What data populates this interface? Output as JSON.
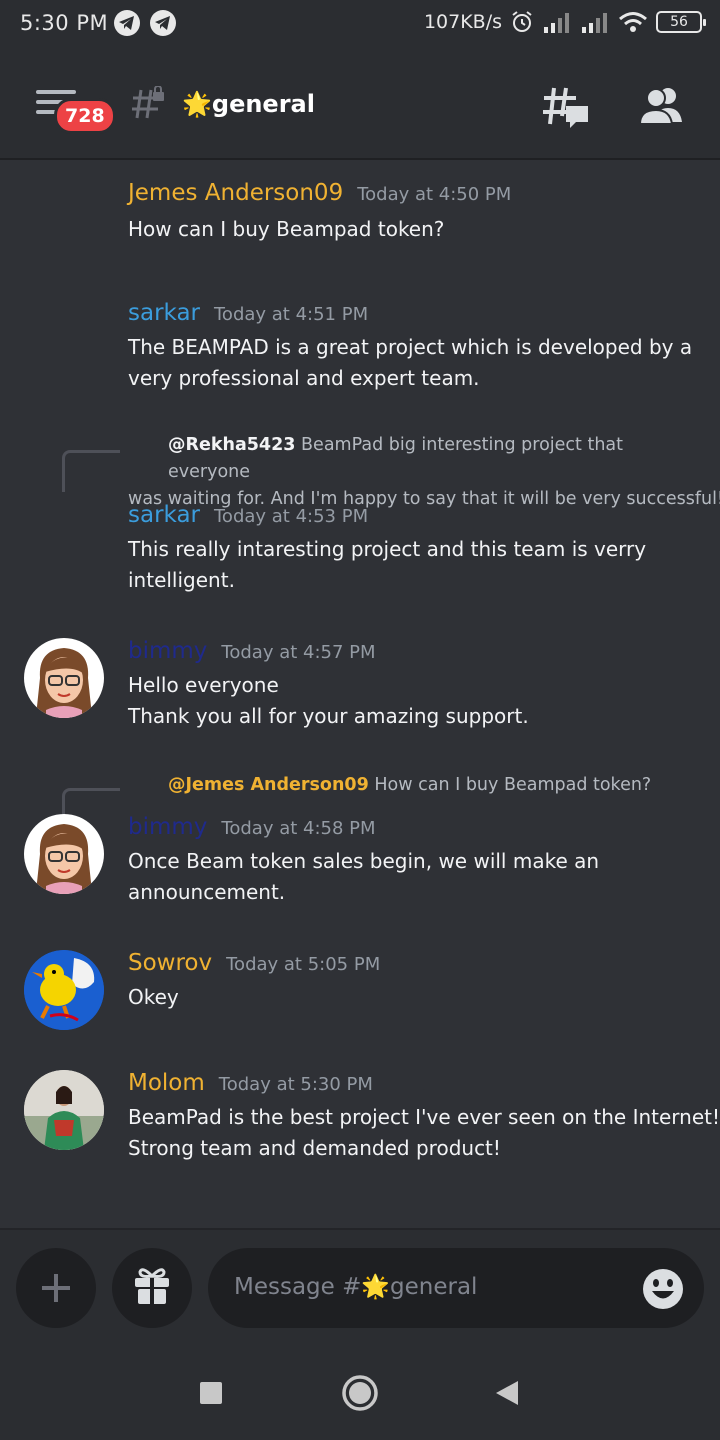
{
  "status_bar": {
    "time": "5:30 PM",
    "net_speed": "107KB/s",
    "battery": "56"
  },
  "header": {
    "unread_badge": "728",
    "channel_name": "🌟general"
  },
  "messages": [
    {
      "author": "Jemes Anderson09",
      "author_color": "#f0b232",
      "timestamp": "Today at 4:50 PM",
      "lines": [
        "How can I buy Beampad token?"
      ]
    },
    {
      "author": "sarkar",
      "author_color": "#3b9ddd",
      "timestamp": "Today at 4:51 PM",
      "lines": [
        "The BEAMPAD is a great project which is developed by a",
        "very professional and expert team."
      ]
    },
    {
      "reply_mention": "@Rekha5423",
      "reply_text": "BeamPad big interesting project that everyone",
      "reply_text_2": "was waiting for. And I'm happy to say that it will be very successful!",
      "author": "sarkar",
      "author_color": "#3b9ddd",
      "timestamp": "Today at 4:53 PM",
      "lines": [
        "This really intaresting project and this team is verry",
        "intelligent."
      ]
    },
    {
      "author": "bimmy",
      "author_color": "#1f2a8c",
      "timestamp": "Today at 4:57 PM",
      "lines": [
        "Hello everyone",
        "Thank you all for your amazing support."
      ]
    },
    {
      "reply_mention": "@Jemes Anderson09",
      "reply_mention_color": "#f0b232",
      "reply_text": "How can I buy Beampad token?",
      "author": "bimmy",
      "author_color": "#1f2a8c",
      "timestamp": "Today at 4:58 PM",
      "lines": [
        "Once Beam token sales begin, we will make an",
        "announcement."
      ]
    },
    {
      "author": "Sowrov",
      "author_color": "#f0b232",
      "timestamp": "Today at 5:05 PM",
      "lines": [
        "Okey"
      ]
    },
    {
      "author": "Molom",
      "author_color": "#f0b232",
      "timestamp": "Today at 5:30 PM",
      "lines": [
        "BeamPad is the best project I've ever seen on the Internet!",
        "Strong team and demanded product!"
      ]
    }
  ],
  "composer": {
    "placeholder": "Message #🌟general"
  },
  "icons": [
    "hamburger-icon",
    "hash-lock-icon",
    "threads-icon",
    "members-icon",
    "plus-icon",
    "gift-icon",
    "emoji-icon",
    "nav-square-icon",
    "nav-home-icon",
    "nav-back-icon"
  ]
}
